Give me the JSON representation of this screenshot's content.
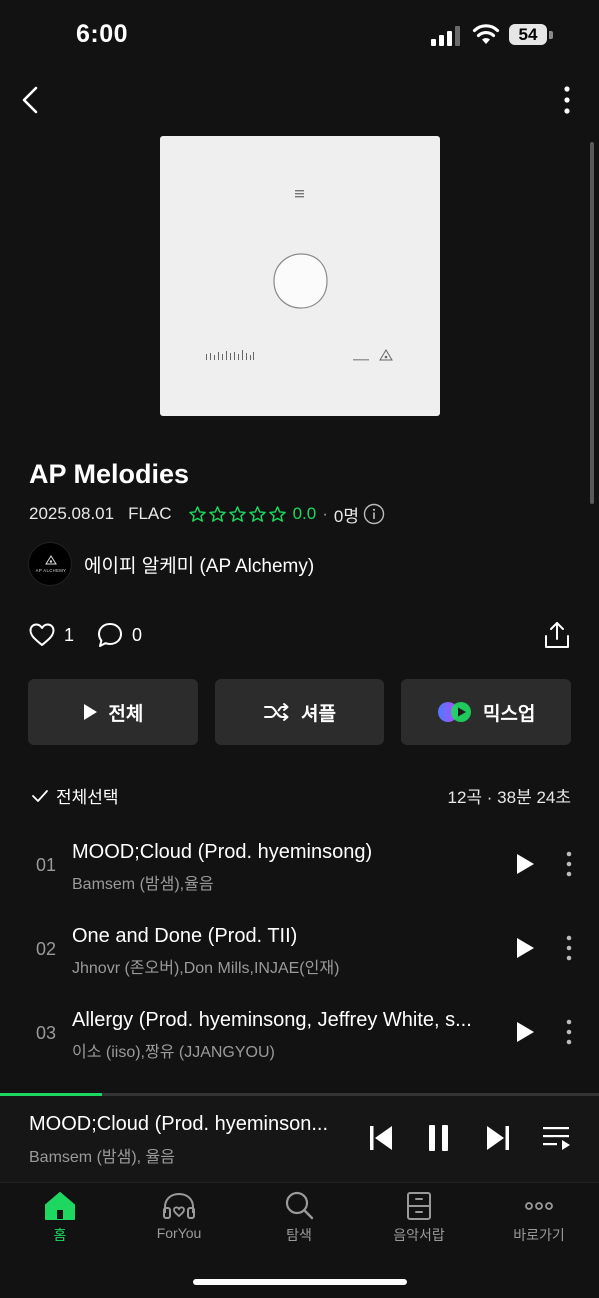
{
  "status_bar": {
    "time": "6:00",
    "battery": "54"
  },
  "album": {
    "title": "AP Melodies",
    "date": "2025.08.01",
    "format": "FLAC",
    "rating": "0.0",
    "separator": "·",
    "raters": "0명",
    "artist": "에이피 알케미 (AP Alchemy)",
    "artist_logo_text": "AP ALCHEMY",
    "stars_filled": 0,
    "stars_total": 5
  },
  "social": {
    "likes": "1",
    "comments": "0"
  },
  "actions": {
    "play_all": "전체",
    "shuffle": "셔플",
    "mixup": "믹스업"
  },
  "list_header": {
    "select_all": "전체선택",
    "summary": "12곡 · 38분 24초"
  },
  "tracks": [
    {
      "no": "01",
      "title": "MOOD;Cloud (Prod. hyeminsong)",
      "artist": "Bamsem (밤샘),율음"
    },
    {
      "no": "02",
      "title": "One and Done (Prod. TII)",
      "artist": "Jhnovr (존오버),Don Mills,INJAE(인재)"
    },
    {
      "no": "03",
      "title": "Allergy (Prod. hyeminsong, Jeffrey White, s...",
      "artist": "이소 (iiso),짱유 (JJANGYOU)"
    }
  ],
  "now_playing": {
    "title": "MOOD;Cloud (Prod. hyeminson...",
    "artist": "Bamsem (밤샘), 율음",
    "progress_percent": 17
  },
  "tabs": [
    {
      "label": "홈",
      "icon": "home-icon",
      "active": true
    },
    {
      "label": "ForYou",
      "icon": "headphones-heart-icon",
      "active": false
    },
    {
      "label": "탐색",
      "icon": "search-icon",
      "active": false
    },
    {
      "label": "음악서랍",
      "icon": "drawer-icon",
      "active": false
    },
    {
      "label": "바로가기",
      "icon": "more-dots-icon",
      "active": false
    }
  ],
  "colors": {
    "accent": "#1ed760",
    "background": "#121212",
    "button": "#2c2c2c"
  }
}
